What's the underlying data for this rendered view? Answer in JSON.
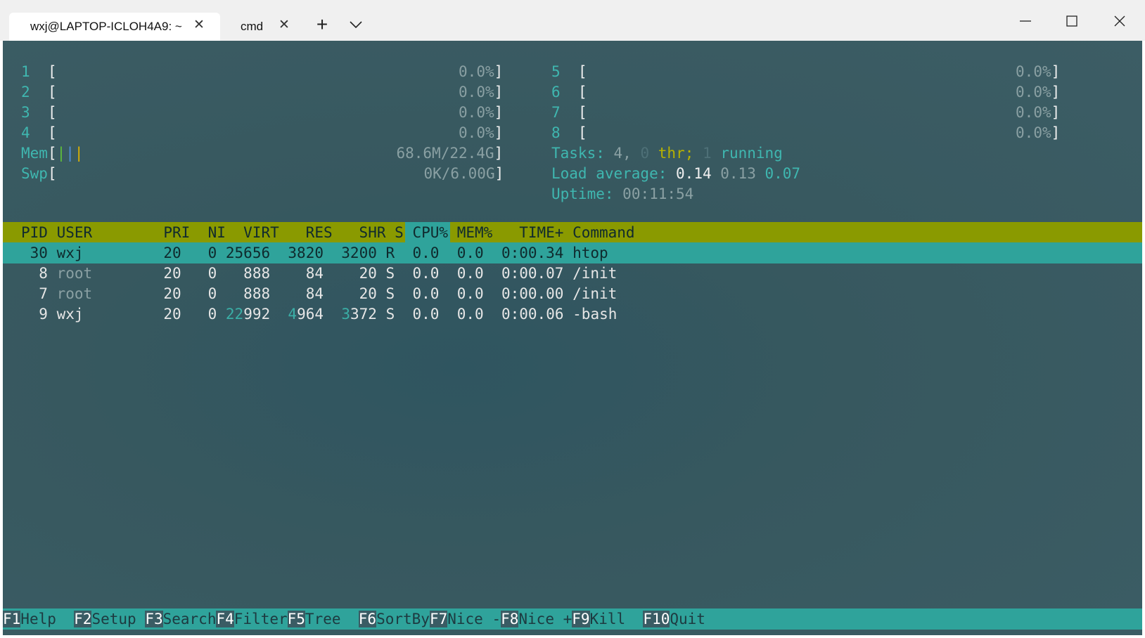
{
  "window": {
    "tabs": [
      {
        "label": "wxj@LAPTOP-ICLOH4A9: ~",
        "active": true
      },
      {
        "label": "cmd",
        "active": false
      }
    ],
    "new_tab_glyph": "+",
    "dropdown_glyph": "⌄",
    "minimize_glyph": "─",
    "maximize_glyph": "☐",
    "close_glyph": "✕",
    "tab_close_glyph": "✕"
  },
  "meters": {
    "cpu": [
      {
        "num": "1",
        "open": "[",
        "value": "0.0%",
        "close": "]"
      },
      {
        "num": "2",
        "open": "[",
        "value": "0.0%",
        "close": "]"
      },
      {
        "num": "3",
        "open": "[",
        "value": "0.0%",
        "close": "]"
      },
      {
        "num": "4",
        "open": "[",
        "value": "0.0%",
        "close": "]"
      },
      {
        "num": "5",
        "open": "[",
        "value": "0.0%",
        "close": "]"
      },
      {
        "num": "6",
        "open": "[",
        "value": "0.0%",
        "close": "]"
      },
      {
        "num": "7",
        "open": "[",
        "value": "0.0%",
        "close": "]"
      },
      {
        "num": "8",
        "open": "[",
        "value": "0.0%",
        "close": "]"
      }
    ],
    "mem": {
      "label": "Mem",
      "open": "[",
      "bars": "|||",
      "value": "68.6M/22.4G",
      "close": "]"
    },
    "swp": {
      "label": "Swp",
      "open": "[",
      "value": "0K/6.00G",
      "close": "]"
    }
  },
  "stats": {
    "tasks_label": "Tasks:",
    "tasks_count": "4,",
    "threads": "0",
    "thr_label": "thr;",
    "running_count": "1",
    "running_label": "running",
    "load_label": "Load average:",
    "load_1": "0.14",
    "load_5": "0.13",
    "load_15": "0.07",
    "uptime_label": "Uptime:",
    "uptime": "00:11:54"
  },
  "table": {
    "columns": [
      "PID",
      "USER",
      "PRI",
      "NI",
      "VIRT",
      "RES",
      "SHR",
      "S",
      "CPU%",
      "MEM%",
      "TIME+",
      "Command"
    ],
    "rows": [
      {
        "pid": "30",
        "user": "wxj",
        "pri": "20",
        "ni": "0",
        "virt": "25656",
        "res": "3820",
        "shr": "3200",
        "s": "R",
        "cpu": "0.0",
        "mem": "0.0",
        "time": "0:00.34",
        "cmd": "htop"
      },
      {
        "pid": "8",
        "user": "root",
        "pri": "20",
        "ni": "0",
        "virt": "888",
        "res": "84",
        "shr": "20",
        "s": "S",
        "cpu": "0.0",
        "mem": "0.0",
        "time": "0:00.07",
        "cmd": "/init"
      },
      {
        "pid": "7",
        "user": "root",
        "pri": "20",
        "ni": "0",
        "virt": "888",
        "res": "84",
        "shr": "20",
        "s": "S",
        "cpu": "0.0",
        "mem": "0.0",
        "time": "0:00.00",
        "cmd": "/init"
      },
      {
        "pid": "9",
        "user": "wxj",
        "pri": "20",
        "ni": "0",
        "virt_hi": "22",
        "virt_lo": "992",
        "res_hi": "4",
        "res_lo": "964",
        "shr_hi": "3",
        "shr_lo": "372",
        "s": "S",
        "cpu": "0.0",
        "mem": "0.0",
        "time": "0:00.06",
        "cmd": "-bash"
      }
    ]
  },
  "fkeys": [
    {
      "key": "F1",
      "label": "Help  "
    },
    {
      "key": "F2",
      "label": "Setup "
    },
    {
      "key": "F3",
      "label": "Search"
    },
    {
      "key": "F4",
      "label": "Filter"
    },
    {
      "key": "F5",
      "label": "Tree  "
    },
    {
      "key": "F6",
      "label": "SortBy"
    },
    {
      "key": "F7",
      "label": "Nice -"
    },
    {
      "key": "F8",
      "label": "Nice +"
    },
    {
      "key": "F9",
      "label": "Kill  "
    },
    {
      "key": "F10",
      "label": "Quit"
    }
  ],
  "colors": {
    "terminal_bg": "#3c5d65",
    "header_bar": "#8a9a00",
    "selected_row": "#2fa39b",
    "accent_cyan": "#3fb7b0"
  }
}
